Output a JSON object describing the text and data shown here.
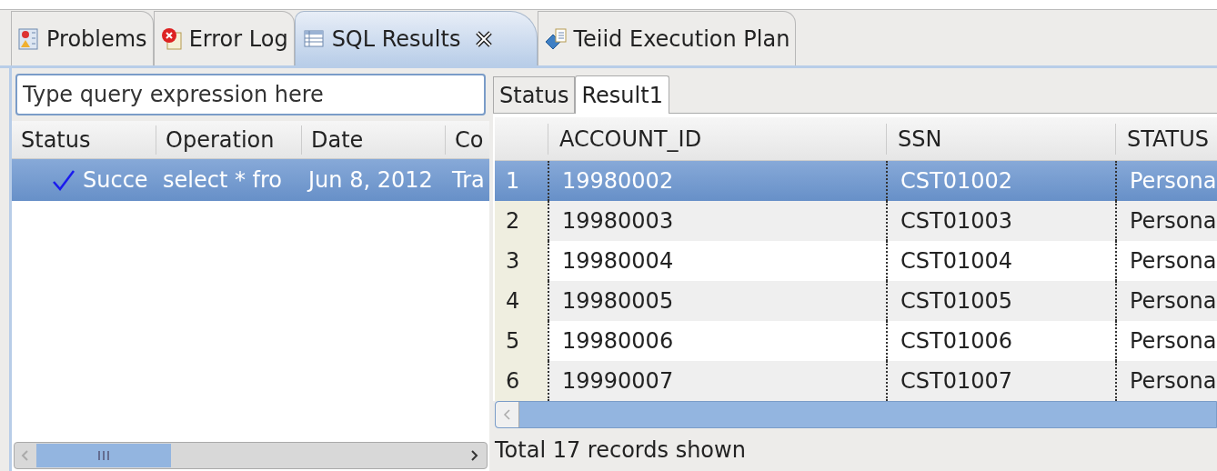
{
  "tabs": [
    {
      "label": "Problems",
      "kind": "problems",
      "selected": false,
      "closable": false
    },
    {
      "label": "Error Log",
      "kind": "errorlog",
      "selected": false,
      "closable": false
    },
    {
      "label": "SQL Results",
      "kind": "table",
      "selected": true,
      "closable": true
    },
    {
      "label": "Teiid Execution Plan",
      "kind": "plan",
      "selected": false,
      "closable": false
    }
  ],
  "filter": {
    "placeholder": "Type query expression here"
  },
  "history": {
    "columns": [
      "Status",
      "Operation",
      "Date",
      "Co"
    ],
    "rows": [
      {
        "cells": [
          "Succe",
          "select * fro",
          "Jun 8, 2012",
          "Tra"
        ],
        "success": true,
        "selected": true
      }
    ]
  },
  "result_tabs": [
    {
      "label": "Status",
      "selected": false
    },
    {
      "label": "Result1",
      "selected": true
    }
  ],
  "results": {
    "columns": [
      "ACCOUNT_ID",
      "SSN",
      "STATUS"
    ],
    "rows": [
      {
        "number": "1",
        "cells": [
          "19980002",
          "CST01002",
          "Persona"
        ],
        "selected": true
      },
      {
        "number": "2",
        "cells": [
          "19980003",
          "CST01003",
          "Persona"
        ],
        "selected": false
      },
      {
        "number": "3",
        "cells": [
          "19980004",
          "CST01004",
          "Persona"
        ],
        "selected": false
      },
      {
        "number": "4",
        "cells": [
          "19980005",
          "CST01005",
          "Persona"
        ],
        "selected": false
      },
      {
        "number": "5",
        "cells": [
          "19980006",
          "CST01006",
          "Persona"
        ],
        "selected": false
      },
      {
        "number": "6",
        "cells": [
          "19990007",
          "CST01007",
          "Persona"
        ],
        "selected": false
      }
    ]
  },
  "status_bar": "Total 17 records shown"
}
